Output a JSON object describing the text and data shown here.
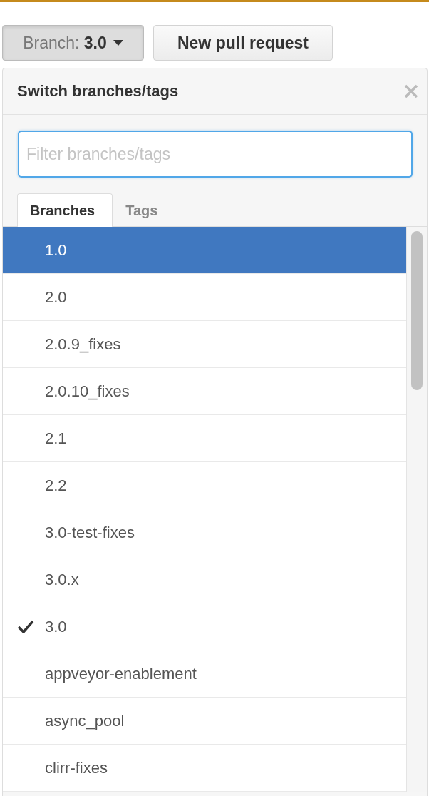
{
  "branch_button": {
    "label": "Branch:",
    "value": "3.0"
  },
  "new_pull_request_button": {
    "label": "New pull request"
  },
  "dropdown": {
    "title": "Switch branches/tags",
    "filter": {
      "placeholder": "Filter branches/tags"
    },
    "tabs": [
      {
        "label": "Branches",
        "selected": true
      },
      {
        "label": "Tags",
        "selected": false
      }
    ],
    "items": [
      {
        "name": "1.0",
        "selected": true,
        "checked": false
      },
      {
        "name": "2.0",
        "selected": false,
        "checked": false
      },
      {
        "name": "2.0.9_fixes",
        "selected": false,
        "checked": false
      },
      {
        "name": "2.0.10_fixes",
        "selected": false,
        "checked": false
      },
      {
        "name": "2.1",
        "selected": false,
        "checked": false
      },
      {
        "name": "2.2",
        "selected": false,
        "checked": false
      },
      {
        "name": "3.0-test-fixes",
        "selected": false,
        "checked": false
      },
      {
        "name": "3.0.x",
        "selected": false,
        "checked": false
      },
      {
        "name": "3.0",
        "selected": false,
        "checked": true
      },
      {
        "name": "appveyor-enablement",
        "selected": false,
        "checked": false
      },
      {
        "name": "async_pool",
        "selected": false,
        "checked": false
      },
      {
        "name": "clirr-fixes",
        "selected": false,
        "checked": false
      }
    ]
  }
}
